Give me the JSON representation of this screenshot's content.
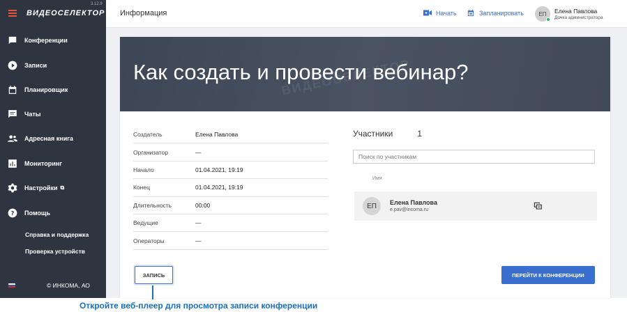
{
  "app": {
    "logo": "ВИДЕОСЕЛЕКТОР",
    "version": "3.12.9"
  },
  "sidebar": {
    "items": [
      {
        "label": "Конференции",
        "icon": "chat-icon"
      },
      {
        "label": "Записи",
        "icon": "play-icon"
      },
      {
        "label": "Планировщик",
        "icon": "calendar-icon"
      },
      {
        "label": "Чаты",
        "icon": "message-icon"
      },
      {
        "label": "Адресная книга",
        "icon": "contacts-icon"
      },
      {
        "label": "Мониторинг",
        "icon": "chart-icon"
      },
      {
        "label": "Настройки",
        "icon": "gear-icon"
      },
      {
        "label": "Помощь",
        "icon": "help-icon"
      }
    ],
    "sub_items": [
      "Справка и поддержка",
      "Проверка устройств"
    ],
    "footer": "© ИНКОМА, АО"
  },
  "header": {
    "title": "Информация",
    "start_label": "Начать",
    "schedule_label": "Запланировать",
    "user_initials": "ЕП",
    "user_name": "Елена Павлова",
    "user_role": "Дочка администратора"
  },
  "conference": {
    "title": "Как создать и провести вебинар?",
    "watermark": "ВИДЕОСЕЛЕКТОР",
    "details": [
      {
        "key": "Создатель",
        "value": "Елена Павлова"
      },
      {
        "key": "Организатор",
        "value": "—"
      },
      {
        "key": "Начало",
        "value": "01.04.2021, 19:19"
      },
      {
        "key": "Конец",
        "value": "01.04.2021, 19:19"
      },
      {
        "key": "Длительность",
        "value": "00:00"
      },
      {
        "key": "Ведущие",
        "value": "—"
      },
      {
        "key": "Операторы",
        "value": "—"
      }
    ],
    "record_button": "ЗАПИСЬ",
    "join_button": "ПЕРЕЙТИ К КОНФЕРЕНЦИИ"
  },
  "participants": {
    "title": "Участники",
    "count": "1",
    "search_placeholder": "Поиск по участникам",
    "column_name": "Имя",
    "rows": [
      {
        "initials": "ЕП",
        "name": "Елена Павлова",
        "email": "e.pav@incoma.ru"
      }
    ]
  },
  "callout": "Откройте веб-плеер для просмотра записи конференции",
  "colors": {
    "accent": "#3a6fd0",
    "sidebar": "#2f3540",
    "callout": "#1a6fc0"
  }
}
